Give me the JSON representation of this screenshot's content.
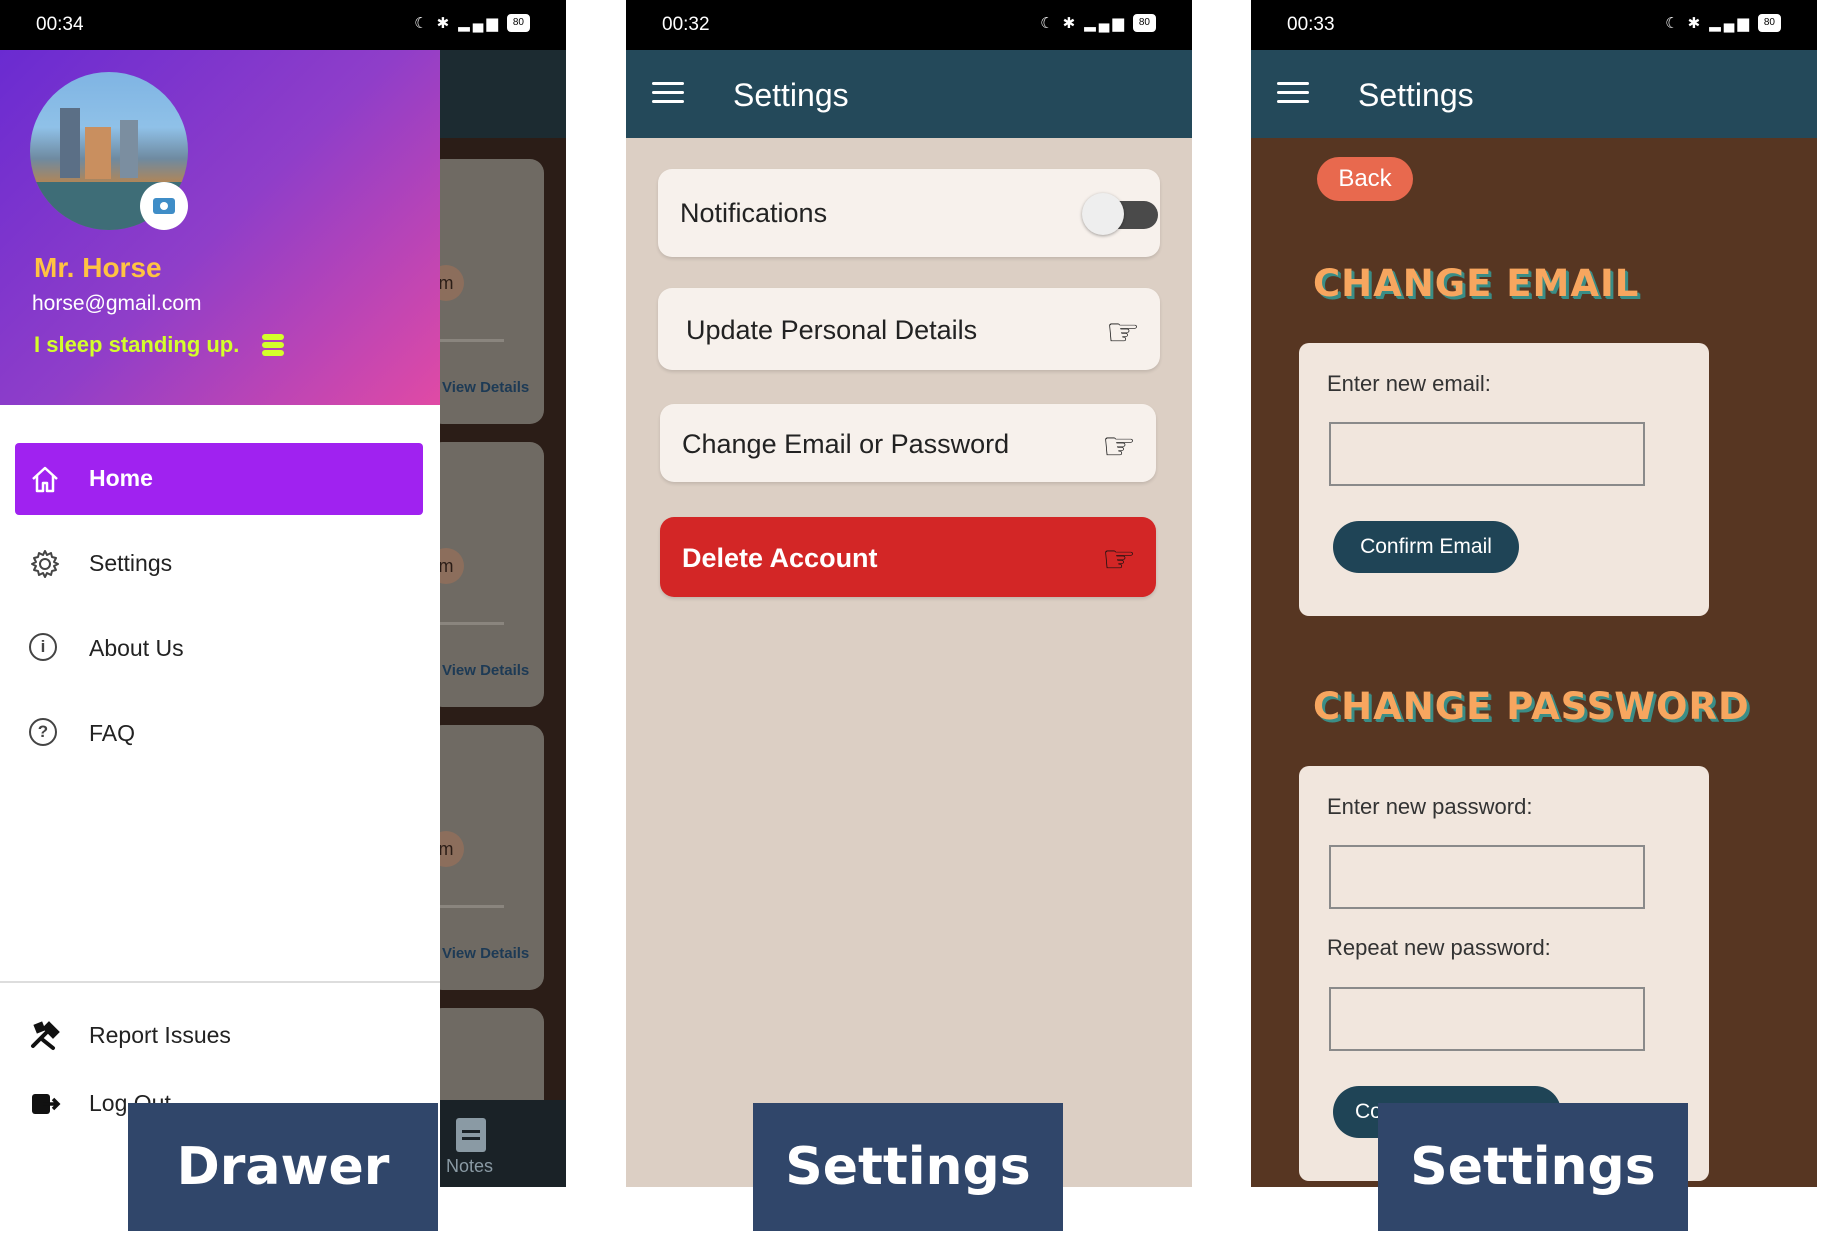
{
  "drawer_screen": {
    "status": {
      "time": "00:34",
      "battery": "80"
    },
    "profile": {
      "name": "Mr. Horse",
      "email": "horse@gmail.com",
      "bio": "I sleep standing up."
    },
    "menu": [
      {
        "label": "Home",
        "icon": "home-icon",
        "active": true
      },
      {
        "label": "Settings",
        "icon": "gear-icon",
        "active": false
      },
      {
        "label": "About Us",
        "icon": "info-icon",
        "active": false
      },
      {
        "label": "FAQ",
        "icon": "question-icon",
        "active": false
      }
    ],
    "footer_menu": [
      {
        "label": "Report Issues",
        "icon": "tools-icon"
      },
      {
        "label": "Log Out",
        "icon": "logout-icon"
      }
    ],
    "background": {
      "card_link": "View Details",
      "card_initial": "m",
      "nav_label": "Notes"
    },
    "caption": "Drawer"
  },
  "settings_screen": {
    "status": {
      "time": "00:32",
      "battery": "80"
    },
    "title": "Settings",
    "rows": {
      "notifications": "Notifications",
      "update_details": "Update Personal Details",
      "change_credentials": "Change Email or Password",
      "delete_account": "Delete Account"
    },
    "notifications_enabled": false,
    "caption": "Settings"
  },
  "change_screen": {
    "status": {
      "time": "00:33",
      "battery": "80"
    },
    "title": "Settings",
    "back": "Back",
    "email_section": {
      "heading": "CHANGE EMAIL",
      "label": "Enter new email:",
      "button": "Confirm Email"
    },
    "password_section": {
      "heading": "CHANGE PASSWORD",
      "label": "Enter new password:",
      "repeat_label": "Repeat new password:",
      "button_partial": "Co"
    },
    "caption": "Settings"
  },
  "colors": {
    "appbar": "#24495a",
    "drawer_active": "#a022f0",
    "delete": "#d32626",
    "back_button": "#e8694e",
    "heading": "#f7a65f",
    "settings_bg": "#dccfc4",
    "change_bg": "#573622"
  }
}
